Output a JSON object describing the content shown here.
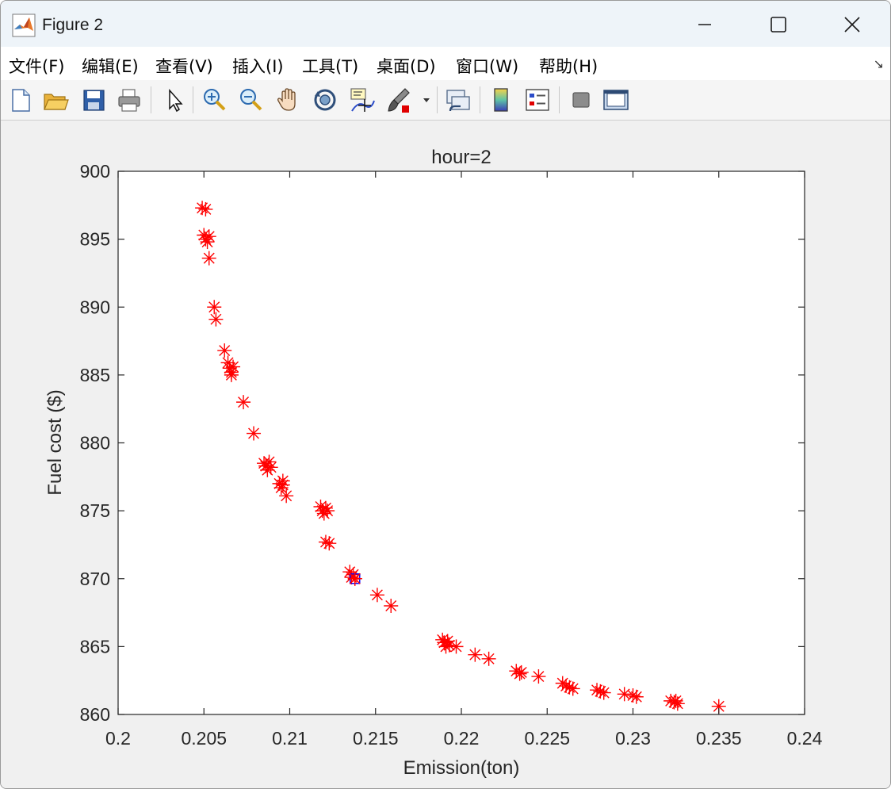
{
  "window": {
    "title": "Figure 2",
    "controls": [
      "minimize",
      "maximize",
      "close"
    ]
  },
  "menu": [
    {
      "label": "文件(F)"
    },
    {
      "label": "编辑(E)"
    },
    {
      "label": "查看(V)"
    },
    {
      "label": "插入(I)"
    },
    {
      "label": "工具(T)"
    },
    {
      "label": "桌面(D)"
    },
    {
      "label": "窗口(W)"
    },
    {
      "label": "帮助(H)"
    }
  ],
  "toolbar": {
    "icons": [
      "new-figure-icon",
      "open-file-icon",
      "save-icon",
      "print-icon",
      "pointer-icon",
      "zoom-in-icon",
      "zoom-out-icon",
      "pan-icon",
      "rotate-3d-icon",
      "data-cursor-icon",
      "brush-icon",
      "link-plot-icon",
      "colorbar-icon",
      "legend-icon",
      "hide-plot-tools-icon",
      "show-plot-tools-icon"
    ]
  },
  "chart_data": {
    "type": "scatter",
    "title": "hour=2",
    "xlabel": "Emission(ton)",
    "ylabel": "Fuel cost ($)",
    "xlim": [
      0.2,
      0.24
    ],
    "ylim": [
      860,
      900
    ],
    "xticks": [
      "0.2",
      "0.205",
      "0.21",
      "0.215",
      "0.22",
      "0.225",
      "0.23",
      "0.235",
      "0.24"
    ],
    "yticks": [
      "860",
      "865",
      "870",
      "875",
      "880",
      "885",
      "890",
      "895",
      "900"
    ],
    "grid": false,
    "marker": "*",
    "colors": {
      "points": "#ff0000",
      "highlight": "#0000ff",
      "axes": "#262626"
    },
    "points": [
      [
        0.2049,
        897.3
      ],
      [
        0.2051,
        897.2
      ],
      [
        0.205,
        895.3
      ],
      [
        0.2051,
        895.0
      ],
      [
        0.2052,
        894.8
      ],
      [
        0.2053,
        895.2
      ],
      [
        0.2053,
        893.6
      ],
      [
        0.2056,
        890.0
      ],
      [
        0.2057,
        889.1
      ],
      [
        0.2062,
        886.8
      ],
      [
        0.2064,
        885.9
      ],
      [
        0.2065,
        885.5
      ],
      [
        0.2066,
        885.2
      ],
      [
        0.2066,
        885.0
      ],
      [
        0.2067,
        885.6
      ],
      [
        0.2073,
        883.0
      ],
      [
        0.2079,
        880.7
      ],
      [
        0.2085,
        878.5
      ],
      [
        0.2086,
        878.3
      ],
      [
        0.2087,
        878.0
      ],
      [
        0.2088,
        878.6
      ],
      [
        0.2089,
        878.2
      ],
      [
        0.2094,
        877.0
      ],
      [
        0.2095,
        876.7
      ],
      [
        0.2096,
        877.2
      ],
      [
        0.2096,
        876.9
      ],
      [
        0.2098,
        876.1
      ],
      [
        0.2118,
        875.3
      ],
      [
        0.2119,
        875.0
      ],
      [
        0.212,
        874.8
      ],
      [
        0.2121,
        875.2
      ],
      [
        0.2122,
        875.0
      ],
      [
        0.2121,
        872.7
      ],
      [
        0.2123,
        872.6
      ],
      [
        0.2135,
        870.5
      ],
      [
        0.2136,
        870.1
      ],
      [
        0.2137,
        870.3
      ],
      [
        0.2138,
        870.0
      ],
      [
        0.2151,
        868.8
      ],
      [
        0.2159,
        868.0
      ],
      [
        0.2189,
        865.5
      ],
      [
        0.219,
        865.3
      ],
      [
        0.2191,
        865.0
      ],
      [
        0.2192,
        865.4
      ],
      [
        0.2193,
        865.1
      ],
      [
        0.2197,
        865.0
      ],
      [
        0.2208,
        864.4
      ],
      [
        0.2216,
        864.1
      ],
      [
        0.2232,
        863.2
      ],
      [
        0.2234,
        863.0
      ],
      [
        0.2235,
        863.1
      ],
      [
        0.2245,
        862.8
      ],
      [
        0.2259,
        862.3
      ],
      [
        0.2261,
        862.1
      ],
      [
        0.2263,
        862.0
      ],
      [
        0.2265,
        861.9
      ],
      [
        0.2279,
        861.8
      ],
      [
        0.2281,
        861.7
      ],
      [
        0.2283,
        861.6
      ],
      [
        0.2295,
        861.5
      ],
      [
        0.23,
        861.4
      ],
      [
        0.2302,
        861.3
      ],
      [
        0.2322,
        861.0
      ],
      [
        0.2324,
        860.9
      ],
      [
        0.2325,
        861.0
      ],
      [
        0.2326,
        860.8
      ],
      [
        0.235,
        860.6
      ]
    ],
    "highlight_points": [
      [
        0.2138,
        870.0
      ]
    ]
  }
}
